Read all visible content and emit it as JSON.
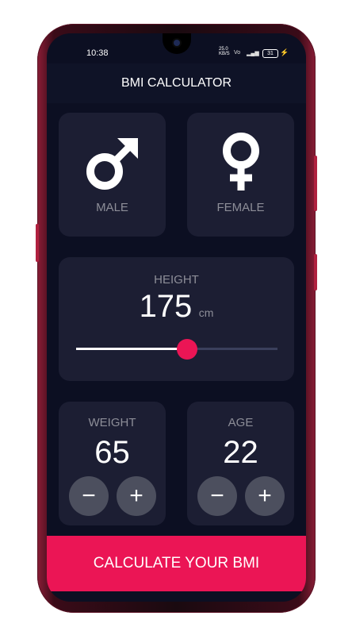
{
  "status_bar": {
    "time": "10:38",
    "net_speed": "25.0",
    "net_unit": "KB/S",
    "battery": "31"
  },
  "app_bar": {
    "title": "BMI CALCULATOR"
  },
  "gender": {
    "male": {
      "label": "MALE",
      "icon": "male-symbol-icon"
    },
    "female": {
      "label": "FEMALE",
      "icon": "female-symbol-icon"
    }
  },
  "height": {
    "label": "HEIGHT",
    "value": "175",
    "unit": "cm",
    "slider_fraction": 0.55
  },
  "weight": {
    "label": "WEIGHT",
    "value": "65",
    "minus": "−",
    "plus": "+"
  },
  "age": {
    "label": "AGE",
    "value": "22",
    "minus": "−",
    "plus": "+"
  },
  "calculate": {
    "label": "CALCULATE YOUR BMI"
  },
  "colors": {
    "background": "#0c0f22",
    "card": "#1c1e33",
    "accent": "#eb1555",
    "muted_text": "#8d8e98",
    "round_button": "#4c4f5e"
  }
}
